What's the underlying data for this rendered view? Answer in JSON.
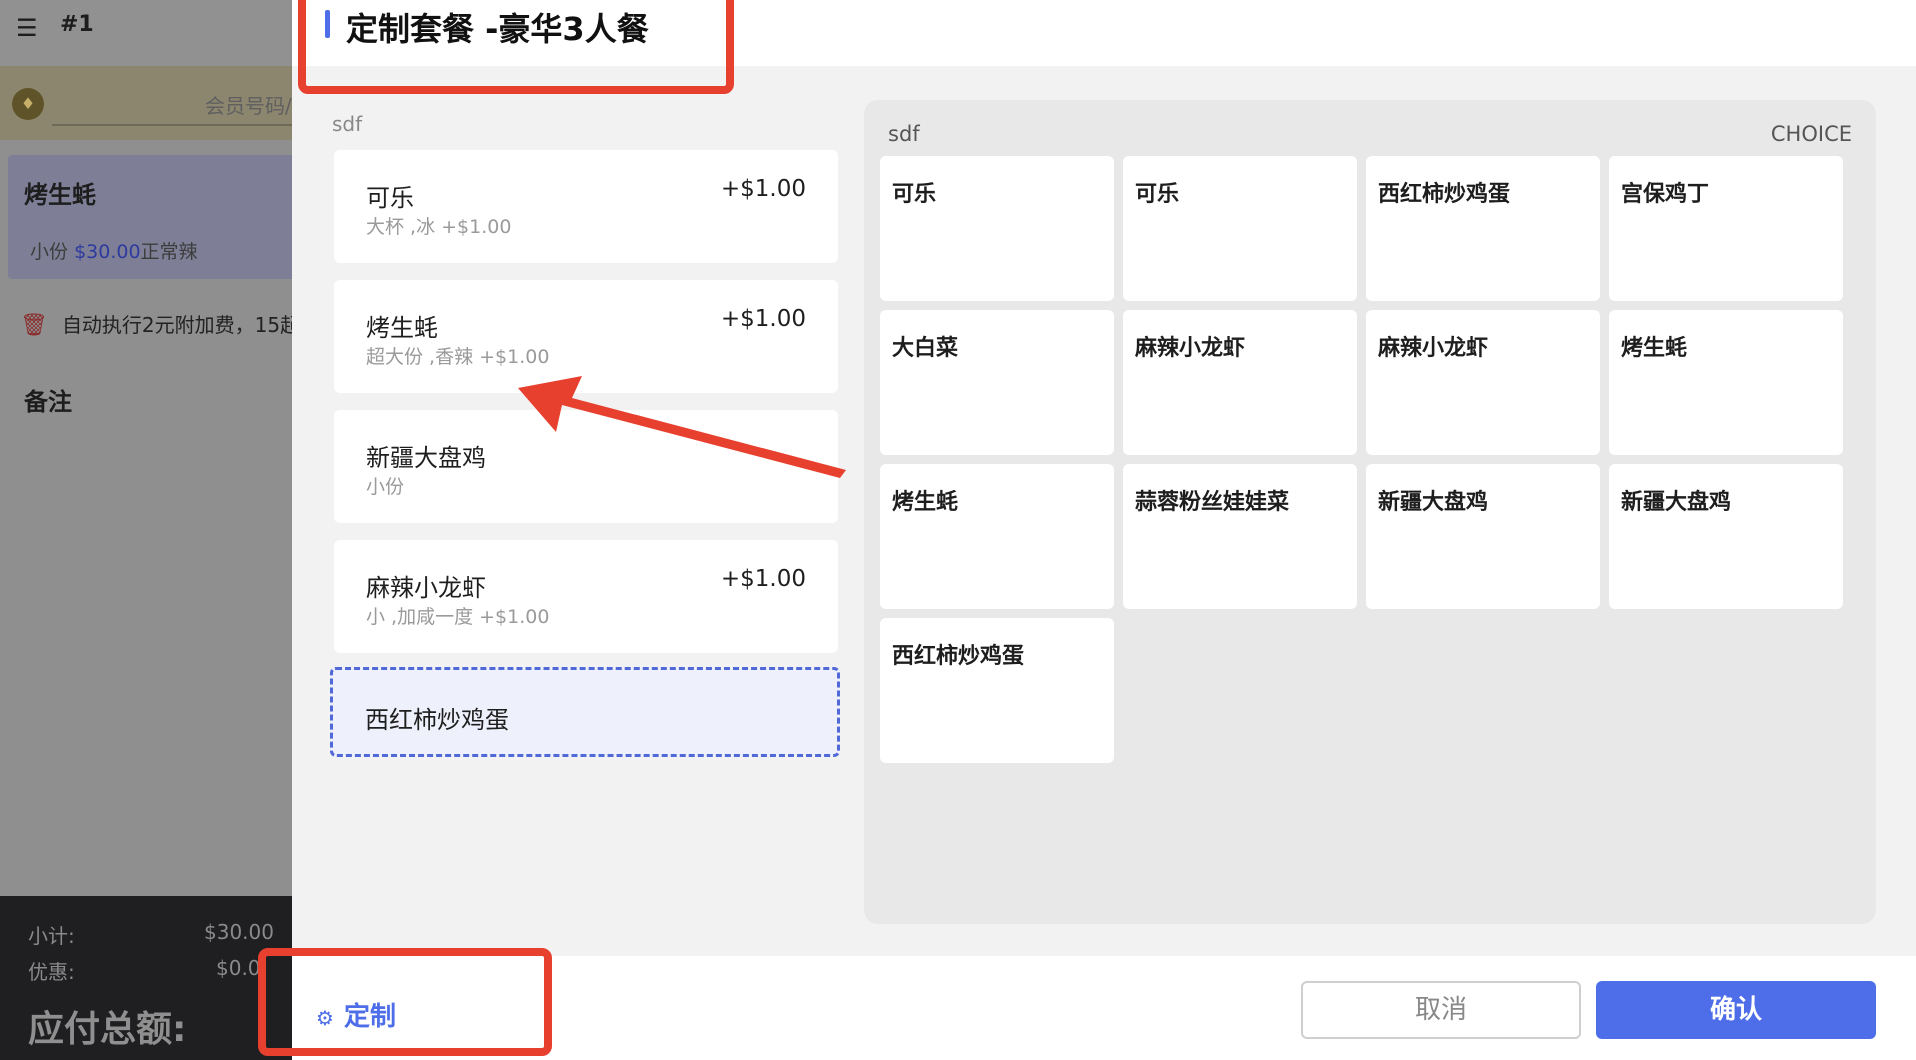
{
  "order_panel": {
    "order_number": "#1",
    "member_placeholder": "会员号码/",
    "item": {
      "name": "烤生蚝",
      "size": "小份",
      "price": "$30.00",
      "spice": "正常辣"
    },
    "surcharge_text": "自动执行2元附加费，15起",
    "remark_label": "备注",
    "subtotal_label": "小计:",
    "subtotal_value": "$30.00",
    "discount_label": "优惠:",
    "discount_value": "$0.0",
    "total_label": "应付总额:"
  },
  "modal": {
    "title": "定制套餐  -豪华3人餐",
    "selected_group_label": "sdf",
    "selected_items": [
      {
        "name": "可乐",
        "detail": "大杯 ,冰  +$1.00",
        "price": "+$1.00"
      },
      {
        "name": "烤生蚝",
        "detail": "超大份 ,香辣  +$1.00",
        "price": "+$1.00"
      },
      {
        "name": "新疆大盘鸡",
        "detail": "小份",
        "price": ""
      },
      {
        "name": "麻辣小龙虾",
        "detail": "小 ,加咸一度  +$1.00",
        "price": "+$1.00"
      },
      {
        "name": "西红柿炒鸡蛋",
        "detail": "",
        "price": ""
      }
    ],
    "choice_group_label": "sdf",
    "choice_tag": "CHOICE",
    "choices": [
      "可乐",
      "可乐",
      "西红柿炒鸡蛋",
      "宫保鸡丁",
      "大白菜",
      "麻辣小龙虾",
      "麻辣小龙虾",
      "烤生蚝",
      "烤生蚝",
      "蒜蓉粉丝娃娃菜",
      "新疆大盘鸡",
      "新疆大盘鸡",
      "西红柿炒鸡蛋"
    ],
    "customize_label": "定制",
    "cancel_label": "取消",
    "confirm_label": "确认"
  },
  "colors": {
    "accent": "#4d6ee8",
    "annotation": "#e8402f",
    "active_item_bg": "#eef0fb"
  }
}
